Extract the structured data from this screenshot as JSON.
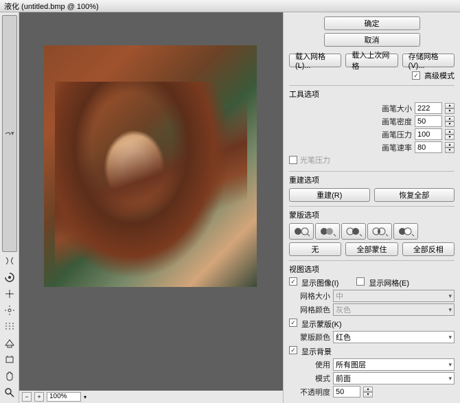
{
  "title": "液化 (untitled.bmp @ 100%)",
  "zoom": "100%",
  "buttons": {
    "ok": "确定",
    "cancel": "取消",
    "loadMesh": "载入网格(L)...",
    "loadLastMesh": "载入上次网格",
    "saveMesh": "存储网格(V)...",
    "reconstruct": "重建(R)",
    "restoreAll": "恢复全部",
    "none": "无",
    "maskAll": "全部蒙住",
    "invertAll": "全部反相"
  },
  "advancedMode": "高级模式",
  "toolOptions": {
    "title": "工具选项",
    "brushSize": {
      "label": "画笔大小",
      "value": "222"
    },
    "brushDensity": {
      "label": "画笔密度",
      "value": "50"
    },
    "brushPressure": {
      "label": "画笔压力",
      "value": "100"
    },
    "brushRate": {
      "label": "画笔速率",
      "value": "80"
    },
    "stylusPressure": "光笔压力"
  },
  "reconstructOptions": {
    "title": "重建选项"
  },
  "maskOptions": {
    "title": "蒙版选项"
  },
  "viewOptions": {
    "title": "视图选项",
    "showImage": "显示图像(I)",
    "showMesh": "显示网格(E)",
    "meshSize": {
      "label": "网格大小",
      "value": "中"
    },
    "meshColor": {
      "label": "网格颜色",
      "value": "灰色"
    },
    "showMask": "显示蒙版(K)",
    "maskColor": {
      "label": "蒙版颜色",
      "value": "红色"
    },
    "showBackdrop": "显示背景",
    "use": {
      "label": "使用",
      "value": "所有图层"
    },
    "mode": {
      "label": "模式",
      "value": "前面"
    },
    "opacity": {
      "label": "不透明度",
      "value": "50"
    }
  }
}
